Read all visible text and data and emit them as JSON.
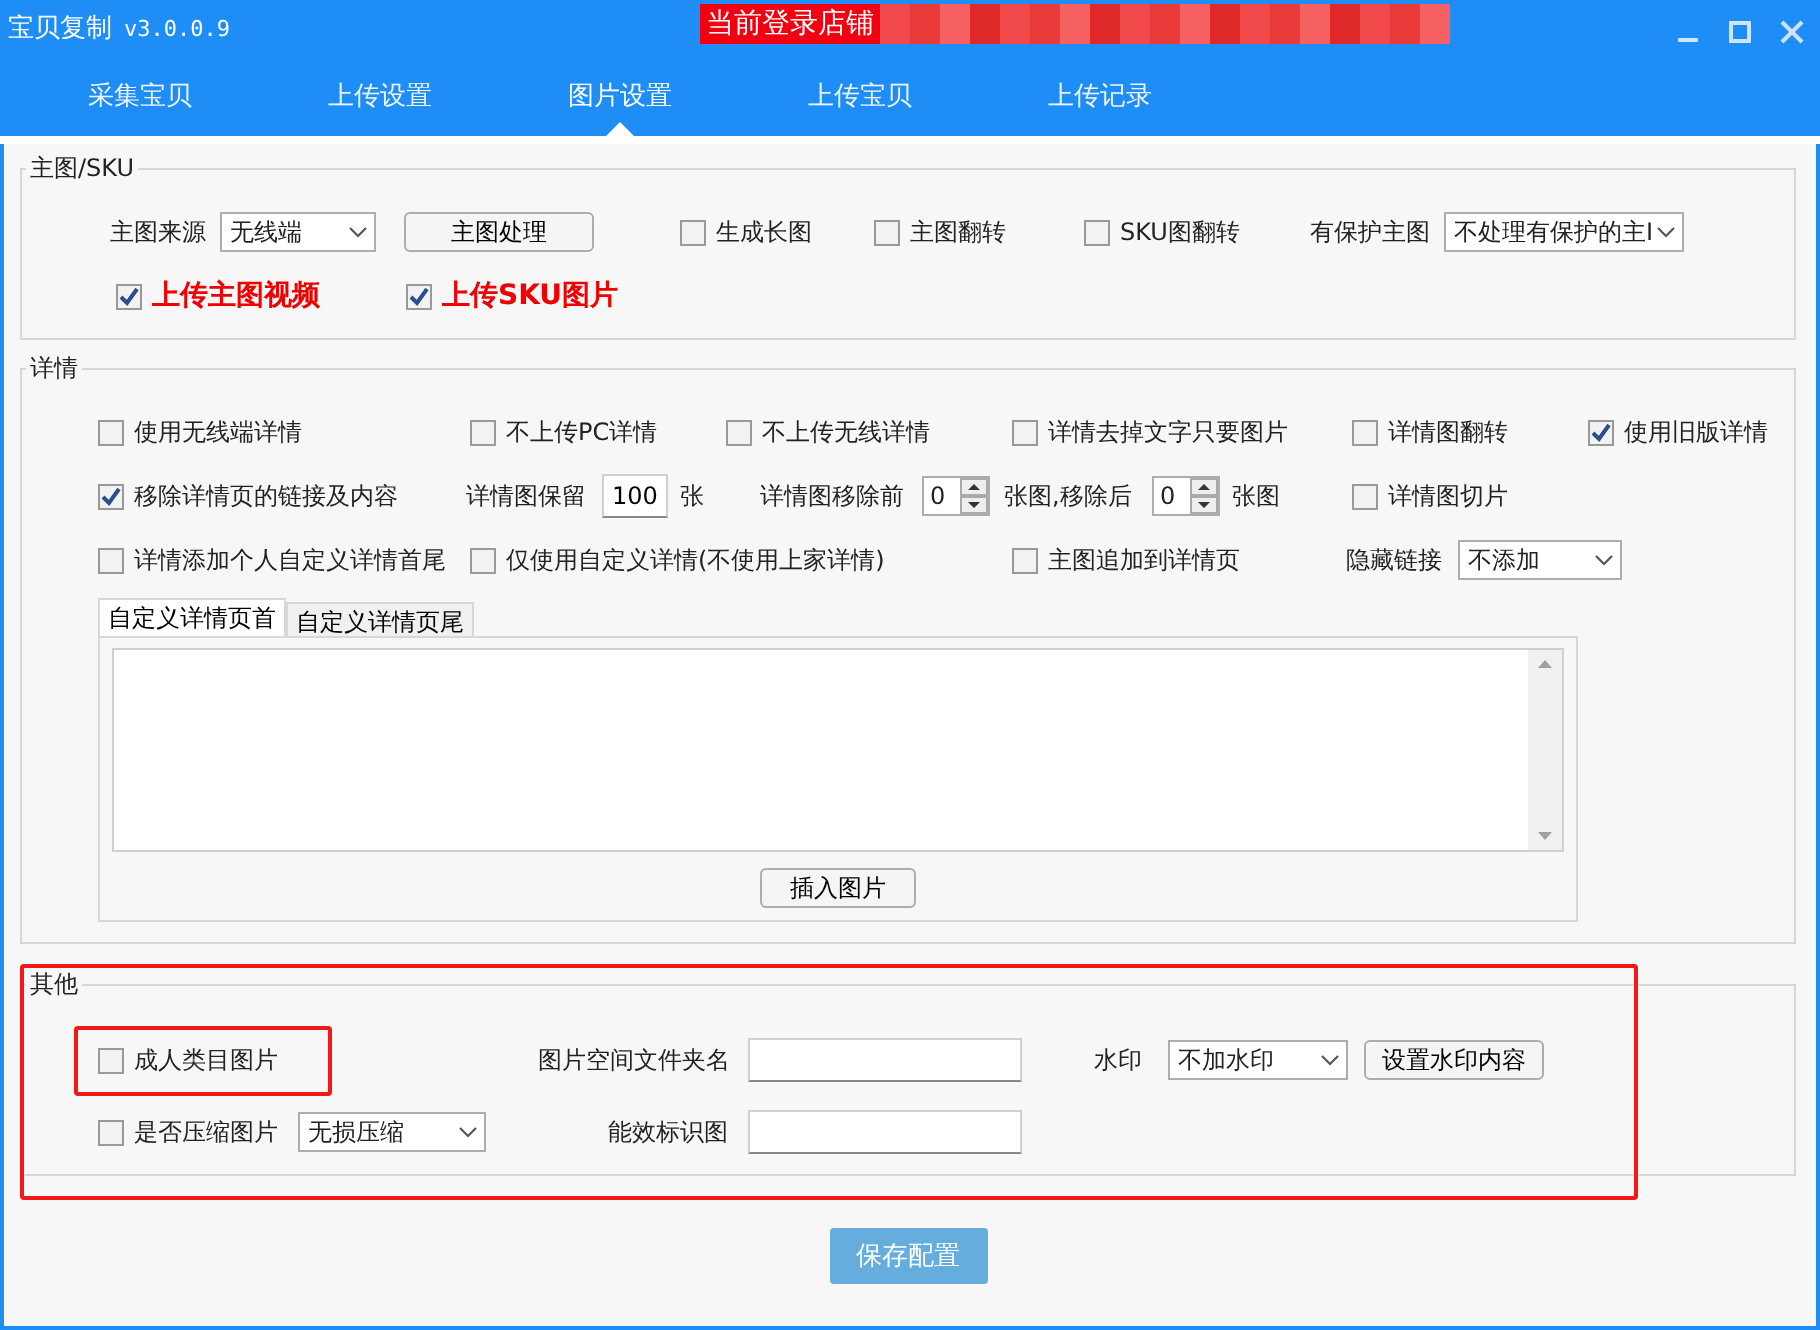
{
  "window": {
    "title": "宝贝复制",
    "version": "v3.0.0.9",
    "shop_label": "当前登录店铺"
  },
  "tabs": [
    {
      "label": "采集宝贝",
      "selected": false
    },
    {
      "label": "上传设置",
      "selected": false
    },
    {
      "label": "图片设置",
      "selected": true
    },
    {
      "label": "上传宝贝",
      "selected": false
    },
    {
      "label": "上传记录",
      "selected": false
    }
  ],
  "sections": [
    {
      "title": "主图/SKU",
      "highlighted": false,
      "rows": [
        {
          "items": [
            {
              "kind": "label",
              "text": "主图来源"
            },
            {
              "kind": "select",
              "value": "无线端"
            },
            {
              "kind": "button",
              "label": "主图处理"
            },
            {
              "kind": "checkbox",
              "label": "生成长图",
              "checked": false,
              "emphasized": false,
              "highlighted": false
            },
            {
              "kind": "checkbox",
              "label": "主图翻转",
              "checked": false,
              "emphasized": false,
              "highlighted": false
            },
            {
              "kind": "checkbox",
              "label": "SKU图翻转",
              "checked": false,
              "emphasized": false,
              "highlighted": false
            },
            {
              "kind": "label",
              "text": "有保护主图"
            },
            {
              "kind": "select",
              "value": "不处理有保护的主I"
            }
          ]
        },
        {
          "items": [
            {
              "kind": "checkbox",
              "label": "上传主图视频",
              "checked": true,
              "emphasized": true,
              "highlighted": false
            },
            {
              "kind": "checkbox",
              "label": "上传SKU图片",
              "checked": true,
              "emphasized": true,
              "highlighted": false
            }
          ]
        }
      ]
    },
    {
      "title": "详情",
      "highlighted": false,
      "rows": [
        {
          "items": [
            {
              "kind": "checkbox",
              "label": "使用无线端详情",
              "checked": false,
              "emphasized": false,
              "highlighted": false
            },
            {
              "kind": "checkbox",
              "label": "不上传PC详情",
              "checked": false,
              "emphasized": false,
              "highlighted": false
            },
            {
              "kind": "checkbox",
              "label": "不上传无线详情",
              "checked": false,
              "emphasized": false,
              "highlighted": false
            },
            {
              "kind": "checkbox",
              "label": "详情去掉文字只要图片",
              "checked": false,
              "emphasized": false,
              "highlighted": false
            },
            {
              "kind": "checkbox",
              "label": "详情图翻转",
              "checked": false,
              "emphasized": false,
              "highlighted": false
            },
            {
              "kind": "checkbox",
              "label": "使用旧版详情",
              "checked": true,
              "emphasized": false,
              "highlighted": false
            }
          ]
        },
        {
          "items": [
            {
              "kind": "checkbox",
              "label": "移除详情页的链接及内容",
              "checked": true,
              "emphasized": false,
              "highlighted": false
            },
            {
              "kind": "label",
              "text": "详情图保留"
            },
            {
              "kind": "input",
              "value": "100"
            },
            {
              "kind": "label",
              "text": "张"
            },
            {
              "kind": "label",
              "text": "详情图移除前"
            },
            {
              "kind": "spinner",
              "value": "0"
            },
            {
              "kind": "label",
              "text": "张图,移除后"
            },
            {
              "kind": "spinner",
              "value": "0"
            },
            {
              "kind": "label",
              "text": "张图"
            },
            {
              "kind": "checkbox",
              "label": "详情图切片",
              "checked": false,
              "emphasized": false,
              "highlighted": false
            }
          ]
        },
        {
          "items": [
            {
              "kind": "checkbox",
              "label": "详情添加个人自定义详情首尾",
              "checked": false,
              "emphasized": false,
              "highlighted": false
            },
            {
              "kind": "checkbox",
              "label": "仅使用自定义详情(不使用上家详情)",
              "checked": false,
              "emphasized": false,
              "highlighted": false
            },
            {
              "kind": "checkbox",
              "label": "主图追加到详情页",
              "checked": false,
              "emphasized": false,
              "highlighted": false
            },
            {
              "kind": "label",
              "text": "隐藏链接"
            },
            {
              "kind": "select",
              "value": "不添加"
            }
          ]
        }
      ],
      "editor": {
        "tabs": [
          {
            "label": "自定义详情页首",
            "selected": true
          },
          {
            "label": "自定义详情页尾",
            "selected": false
          }
        ],
        "button": "插入图片"
      }
    },
    {
      "title": "其他",
      "highlighted": true,
      "rows": [
        {
          "items": [
            {
              "kind": "checkbox",
              "label": "成人类目图片",
              "checked": false,
              "emphasized": false,
              "highlighted": true
            },
            {
              "kind": "label",
              "text": "图片空间文件夹名"
            },
            {
              "kind": "input"
            },
            {
              "kind": "label",
              "text": "水印"
            },
            {
              "kind": "select",
              "value": "不加水印"
            },
            {
              "kind": "button",
              "label": "设置水印内容"
            }
          ]
        },
        {
          "items": [
            {
              "kind": "checkbox",
              "label": "是否压缩图片",
              "checked": false,
              "emphasized": false,
              "highlighted": false
            },
            {
              "kind": "select",
              "value": "无损压缩"
            },
            {
              "kind": "label",
              "text": "能效标识图"
            },
            {
              "kind": "input"
            }
          ]
        }
      ]
    }
  ],
  "save_button": "保存配置"
}
